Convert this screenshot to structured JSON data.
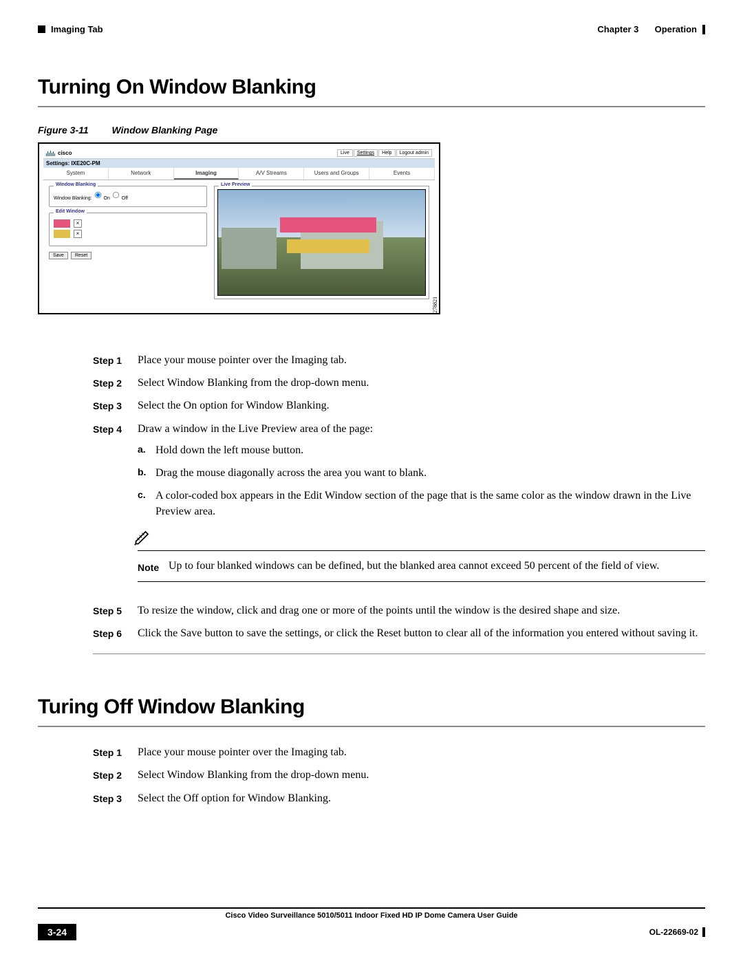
{
  "header": {
    "left": "Imaging Tab",
    "right_chapter": "Chapter 3",
    "right_title": "Operation"
  },
  "section1": {
    "title": "Turning On Window Blanking",
    "figure_no": "Figure 3-11",
    "figure_title": "Window Blanking Page",
    "side_number": "278821"
  },
  "app": {
    "brand": "cisco",
    "toplinks": [
      "Live",
      "Settings",
      "Help",
      "Logout admin"
    ],
    "settings_label": "Settings: IXE20C-PM",
    "tabs": [
      "System",
      "Network",
      "Imaging",
      "A/V Streams",
      "Users and Groups",
      "Events"
    ],
    "wb_legend": "Window Blanking",
    "wb_label": "Window Blanking:",
    "wb_on": "On",
    "wb_off": "Off",
    "edit_legend": "Edit Window",
    "preview_legend": "Live Preview",
    "save": "Save",
    "reset": "Reset",
    "x": "×"
  },
  "steps_on": [
    {
      "label": "Step 1",
      "body": "Place your mouse pointer over the Imaging tab."
    },
    {
      "label": "Step 2",
      "body": "Select Window Blanking from the drop-down menu."
    },
    {
      "label": "Step 3",
      "body": "Select the On option for Window Blanking."
    },
    {
      "label": "Step 4",
      "body": "Draw a window in the Live Preview area of the page:"
    }
  ],
  "substeps": [
    {
      "label": "a.",
      "body": "Hold down the left mouse button."
    },
    {
      "label": "b.",
      "body": "Drag the mouse diagonally across the area you want to blank."
    },
    {
      "label": "c.",
      "body": "A color-coded box appears in the Edit Window section of the page that is the same color as the window drawn in the Live Preview area."
    }
  ],
  "note": {
    "label": "Note",
    "body": "Up to four blanked windows can be defined, but the blanked area cannot exceed 50 percent of the field of view."
  },
  "steps_on_cont": [
    {
      "label": "Step 5",
      "body": "To resize the window, click and drag one or more of the points until the window is the desired shape and size."
    },
    {
      "label": "Step 6",
      "body": "Click the Save button to save the settings, or click the Reset button to clear all of the information you entered without saving it."
    }
  ],
  "section2": {
    "title": "Turing Off Window Blanking"
  },
  "steps_off": [
    {
      "label": "Step 1",
      "body": "Place your mouse pointer over the Imaging tab."
    },
    {
      "label": "Step 2",
      "body": "Select Window Blanking from the drop-down menu."
    },
    {
      "label": "Step 3",
      "body": "Select the Off option for Window Blanking."
    }
  ],
  "footer": {
    "title": "Cisco Video Surveillance 5010/5011 Indoor Fixed HD IP Dome Camera User Guide",
    "page": "3-24",
    "docno": "OL-22669-02"
  }
}
